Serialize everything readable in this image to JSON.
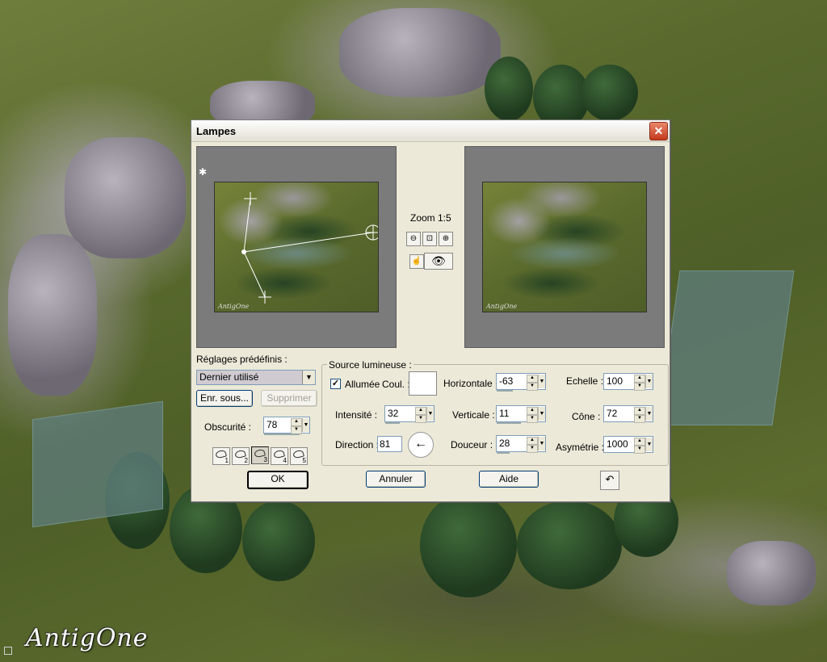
{
  "window": {
    "title": "Lampes",
    "close_glyph": "✕"
  },
  "zoom": {
    "label": "Zoom 1:5"
  },
  "presets": {
    "section_label": "Réglages prédéfinis :",
    "selected": "Dernier utilisé",
    "save_as": "Enr. sous...",
    "delete": "Supprimer",
    "obscurity_label": "Obscurité :",
    "obscurity_value": "78",
    "slots": [
      "1",
      "2",
      "3",
      "4",
      "5"
    ],
    "active_slot": 3
  },
  "light_source": {
    "group_title": "Source lumineuse :",
    "on_label": "Allumée",
    "on_checked": true,
    "color_label": "Coul. :",
    "color": "#ffffff",
    "horizontal_label": "Horizontale :",
    "horizontal_value": "-63",
    "scale_label": "Echelle :",
    "scale_value": "100",
    "intensity_label": "Intensité :",
    "intensity_value": "32",
    "vertical_label": "Verticale :",
    "vertical_value": "11",
    "cone_label": "Cône :",
    "cone_value": "72",
    "direction_label": "Direction :",
    "direction_value": "81",
    "softness_label": "Douceur :",
    "softness_value": "28",
    "asymmetry_label": "Asymétrie :",
    "asymmetry_value": "1000"
  },
  "buttons": {
    "ok": "OK",
    "cancel": "Annuler",
    "help": "Aide"
  },
  "icons": {
    "zoom_out": "magnifier-minus-icon",
    "zoom_fit": "zoom-fit-icon",
    "zoom_in": "magnifier-plus-icon",
    "pan": "hand-icon",
    "eye": "eye-icon",
    "reset": "reset-icon",
    "direction_arrow": "arrow-left-icon"
  },
  "watermark": {
    "text": "AntigOne"
  },
  "scene_watermark": {
    "text": "AntigOne"
  },
  "colors": {
    "dialog_bg": "#ece9d8",
    "close_red": "#c4391c",
    "preview_gray": "#7b7b7b"
  }
}
